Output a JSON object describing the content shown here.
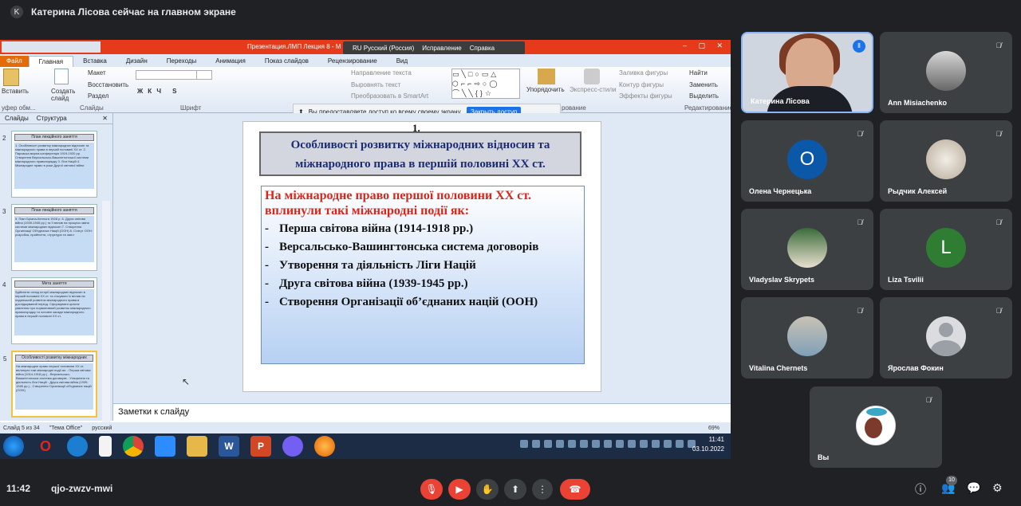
{
  "header": {
    "avatar_letter": "K",
    "presenting_text": "Катерина Лісова сейчас на главном экране"
  },
  "ppt": {
    "window_title": "Презентация.ЛМП Лекция 8 - M",
    "lang_bar": {
      "lang": "RU Русский (Россия)",
      "fix": "Исправление",
      "help": "Справка"
    },
    "tabs": [
      "Файл",
      "Главная",
      "Вставка",
      "Дизайн",
      "Переходы",
      "Анимация",
      "Показ слайдов",
      "Рецензирование",
      "Вид"
    ],
    "ribbon": {
      "paste": "Вставить",
      "create_slide": "Создать слайд",
      "layout": "Макет",
      "restore": "Восстановить",
      "section": "Раздел",
      "text_direction": "Направление текста",
      "align_text": "Выровнять текст",
      "smartart": "Преобразовать в SmartArt",
      "arrange": "Упорядочить",
      "quick_styles": "Экспресс-стили",
      "fill": "Заливка фигуры",
      "outline": "Контур фигуры",
      "effects": "Эффекты фигуры",
      "find": "Найти",
      "replace": "Заменить",
      "select": "Выделить",
      "group_clipboard": "уфер обм...",
      "group_slides": "Слайды",
      "group_font": "Шрифт",
      "group_drawing": "рование",
      "group_editing": "Редактирование"
    },
    "share_notice": {
      "text": "Вы предоставляете доступ ко всему своему экрану.",
      "button": "Закрыть доступ"
    },
    "panel_tabs": [
      "Слайды",
      "Структура"
    ],
    "thumbs": [
      {
        "num": "2",
        "title": "План лекційного заняття",
        "body": "1. Особливості розвитку міжнародних відносин та міжнародного права в першій половині XX ст. 2. Паризька мирна конференція 1919-1920 рр. Створення Версальсько-Вашингтонської системи міжнародного правопорядку 3. Ліга Націй 4. Міжнародне право в роки Другої світової війни"
      },
      {
        "num": "3",
        "title": "План лекційного заняття",
        "body": "5. Пакт Бріана-Келлога 1928 р. 6. Друга світова війна (1939-1945 рр.) та її вплив на процеси зміни системи міжнародних відносин 7. Створення Організації Об'єднаних Націй (ООН) 8. Статут ООН: розробка, прийняття, структура та зміст"
      },
      {
        "num": "4",
        "title": "Мета заняття",
        "body": "Здійснити огляд історії міжнародних відносин в першій половині XX ст. та з'ясувати їх вплив на подальший розвиток міжнародного права в досліджуваний період. Сформувати цілісне уявлення про нормативний розвиток міжнародного правопорядку та основні засади міжнародного права в першій половині XX ст."
      },
      {
        "num": "5",
        "title": "Особливості розвитку міжнародних відносин та міжнародного права в першій половині XX ст.",
        "body": "На міжнародне право першої половини XX ст. вплинули такі міжнародні події як: - Перша світова війна (1914-1918 рр.) - Версальсько-Вашингтонська система договорів - Утворення та діяльність Ліги Націй - Друга світова війна (1939-1945 рр.) - Створення Організації об'єднаних націй (ООН)"
      }
    ],
    "slide": {
      "number": "1.",
      "title": "Особливості розвитку міжнародних відносин та міжнародного права в першій половині XX ст.",
      "lead": "На міжнародне право першої половини XX ст. вплинули такі міжнародні події як:",
      "bullets": [
        "Перша світова війна (1914-1918 рр.)",
        "Версальсько-Вашингтонська система договорів",
        "Утворення та діяльність Ліги Націй",
        "Друга світова війна (1939-1945 рр.)",
        "Створення Організації об’єднаних націй (ООН)"
      ],
      "dash": "-"
    },
    "notes_placeholder": "Заметки к слайду",
    "status": {
      "slide": "Слайд 5 из 34",
      "theme": "\"Тема Office\"",
      "lang": "русский",
      "zoom": "69%"
    },
    "clock": {
      "time": "11:41",
      "date": "03.10.2022"
    },
    "taskbar_apps": [
      "opera",
      "edge",
      "file",
      "chrome",
      "zoom",
      "explorer",
      "word",
      "powerpoint",
      "viber",
      "firefox"
    ]
  },
  "participants": [
    {
      "name": "Катерина Лісова",
      "speaking": true
    },
    {
      "name": "Ann Misiachenko"
    },
    {
      "name": "Олена Чернецька",
      "letter": "O",
      "color": "#0b57a8"
    },
    {
      "name": "Рыдчик Алексей"
    },
    {
      "name": "Vladyslav Skrypets"
    },
    {
      "name": "Liza Tsvilii",
      "letter": "L",
      "color": "#2e7d32"
    },
    {
      "name": "Vitalina Chernets"
    },
    {
      "name": "Ярослав Фокин"
    },
    {
      "name": "Вы"
    }
  ],
  "bottom": {
    "time": "11:42",
    "meeting_code": "qjo-zwzv-mwi",
    "people_count": "10"
  }
}
